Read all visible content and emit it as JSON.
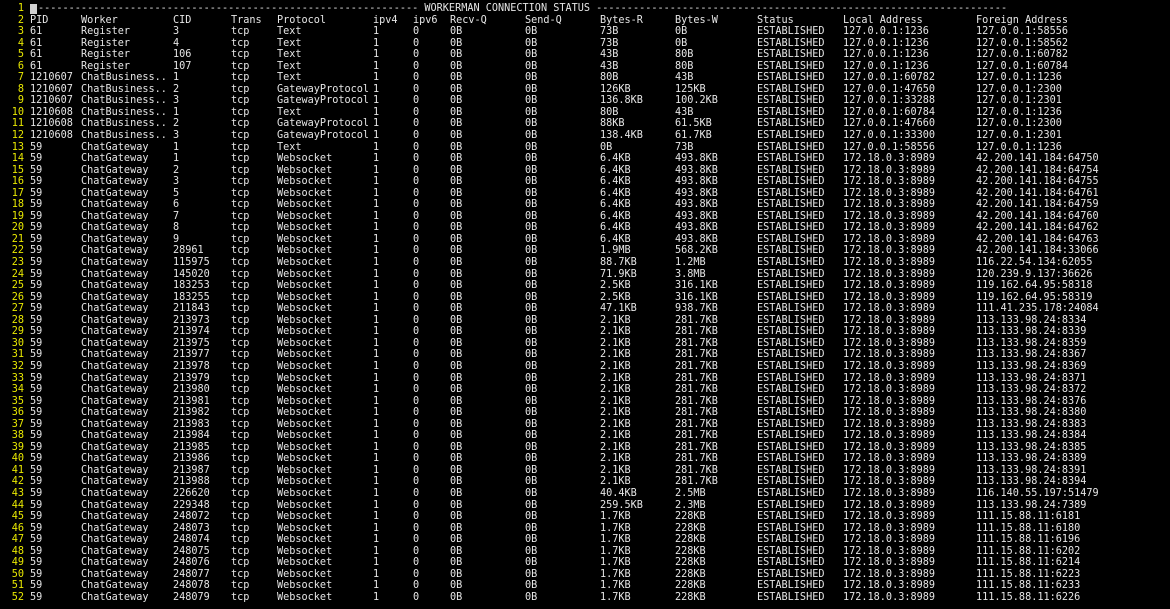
{
  "title_line": "-------------------------------------------------------------- WORKERMAN CONNECTION STATUS -------------------------------------------------------------------",
  "line_numbers": [
    "1",
    "2",
    "3",
    "4",
    "5",
    "6",
    "7",
    "8",
    "9",
    "10",
    "11",
    "12",
    "13",
    "14",
    "15",
    "16",
    "17",
    "18",
    "19",
    "20",
    "21",
    "22",
    "23",
    "24",
    "25",
    "26",
    "27",
    "28",
    "29",
    "30",
    "31",
    "32",
    "33",
    "34",
    "35",
    "36",
    "37",
    "38",
    "39",
    "40",
    "41",
    "42",
    "43",
    "44",
    "45",
    "46",
    "47",
    "48",
    "49",
    "50",
    "51",
    "52"
  ],
  "header": [
    "PID",
    "Worker",
    "CID",
    "Trans",
    "Protocol",
    "ipv4",
    "ipv6",
    "Recv-Q",
    "Send-Q",
    "Bytes-R",
    "Bytes-W",
    "Status",
    "Local Address",
    "Foreign Address"
  ],
  "rows": [
    [
      "61",
      "Register",
      "3",
      "tcp",
      "Text",
      "1",
      "0",
      "0B",
      "0B",
      "73B",
      "0B",
      "ESTABLISHED",
      "127.0.0.1:1236",
      "127.0.0.1:58556"
    ],
    [
      "61",
      "Register",
      "4",
      "tcp",
      "Text",
      "1",
      "0",
      "0B",
      "0B",
      "73B",
      "0B",
      "ESTABLISHED",
      "127.0.0.1:1236",
      "127.0.0.1:58562"
    ],
    [
      "61",
      "Register",
      "106",
      "tcp",
      "Text",
      "1",
      "0",
      "0B",
      "0B",
      "43B",
      "80B",
      "ESTABLISHED",
      "127.0.0.1:1236",
      "127.0.0.1:60782"
    ],
    [
      "61",
      "Register",
      "107",
      "tcp",
      "Text",
      "1",
      "0",
      "0B",
      "0B",
      "43B",
      "80B",
      "ESTABLISHED",
      "127.0.0.1:1236",
      "127.0.0.1:60784"
    ],
    [
      "1210607",
      "ChatBusiness..",
      "1",
      "tcp",
      "Text",
      "1",
      "0",
      "0B",
      "0B",
      "80B",
      "43B",
      "ESTABLISHED",
      "127.0.0.1:60782",
      "127.0.0.1:1236"
    ],
    [
      "1210607",
      "ChatBusiness..",
      "2",
      "tcp",
      "GatewayProtocol",
      "1",
      "0",
      "0B",
      "0B",
      "126KB",
      "125KB",
      "ESTABLISHED",
      "127.0.0.1:47650",
      "127.0.0.1:2300"
    ],
    [
      "1210607",
      "ChatBusiness..",
      "3",
      "tcp",
      "GatewayProtocol",
      "1",
      "0",
      "0B",
      "0B",
      "136.8KB",
      "100.2KB",
      "ESTABLISHED",
      "127.0.0.1:33288",
      "127.0.0.1:2301"
    ],
    [
      "1210608",
      "ChatBusiness..",
      "1",
      "tcp",
      "Text",
      "1",
      "0",
      "0B",
      "0B",
      "80B",
      "43B",
      "ESTABLISHED",
      "127.0.0.1:60784",
      "127.0.0.1:1236"
    ],
    [
      "1210608",
      "ChatBusiness..",
      "2",
      "tcp",
      "GatewayProtocol",
      "1",
      "0",
      "0B",
      "0B",
      "88KB",
      "61.5KB",
      "ESTABLISHED",
      "127.0.0.1:47660",
      "127.0.0.1:2300"
    ],
    [
      "1210608",
      "ChatBusiness..",
      "3",
      "tcp",
      "GatewayProtocol",
      "1",
      "0",
      "0B",
      "0B",
      "138.4KB",
      "61.7KB",
      "ESTABLISHED",
      "127.0.0.1:33300",
      "127.0.0.1:2301"
    ],
    [
      "59",
      "ChatGateway",
      "1",
      "tcp",
      "Text",
      "1",
      "0",
      "0B",
      "0B",
      "0B",
      "73B",
      "ESTABLISHED",
      "127.0.0.1:58556",
      "127.0.0.1:1236"
    ],
    [
      "59",
      "ChatGateway",
      "1",
      "tcp",
      "Websocket",
      "1",
      "0",
      "0B",
      "0B",
      "6.4KB",
      "493.8KB",
      "ESTABLISHED",
      "172.18.0.3:8989",
      "42.200.141.184:64750"
    ],
    [
      "59",
      "ChatGateway",
      "2",
      "tcp",
      "Websocket",
      "1",
      "0",
      "0B",
      "0B",
      "6.4KB",
      "493.8KB",
      "ESTABLISHED",
      "172.18.0.3:8989",
      "42.200.141.184:64754"
    ],
    [
      "59",
      "ChatGateway",
      "3",
      "tcp",
      "Websocket",
      "1",
      "0",
      "0B",
      "0B",
      "6.4KB",
      "493.8KB",
      "ESTABLISHED",
      "172.18.0.3:8989",
      "42.200.141.184:64755"
    ],
    [
      "59",
      "ChatGateway",
      "5",
      "tcp",
      "Websocket",
      "1",
      "0",
      "0B",
      "0B",
      "6.4KB",
      "493.8KB",
      "ESTABLISHED",
      "172.18.0.3:8989",
      "42.200.141.184:64761"
    ],
    [
      "59",
      "ChatGateway",
      "6",
      "tcp",
      "Websocket",
      "1",
      "0",
      "0B",
      "0B",
      "6.4KB",
      "493.8KB",
      "ESTABLISHED",
      "172.18.0.3:8989",
      "42.200.141.184:64759"
    ],
    [
      "59",
      "ChatGateway",
      "7",
      "tcp",
      "Websocket",
      "1",
      "0",
      "0B",
      "0B",
      "6.4KB",
      "493.8KB",
      "ESTABLISHED",
      "172.18.0.3:8989",
      "42.200.141.184:64760"
    ],
    [
      "59",
      "ChatGateway",
      "8",
      "tcp",
      "Websocket",
      "1",
      "0",
      "0B",
      "0B",
      "6.4KB",
      "493.8KB",
      "ESTABLISHED",
      "172.18.0.3:8989",
      "42.200.141.184:64762"
    ],
    [
      "59",
      "ChatGateway",
      "9",
      "tcp",
      "Websocket",
      "1",
      "0",
      "0B",
      "0B",
      "6.4KB",
      "493.8KB",
      "ESTABLISHED",
      "172.18.0.3:8989",
      "42.200.141.184:64763"
    ],
    [
      "59",
      "ChatGateway",
      "28961",
      "tcp",
      "Websocket",
      "1",
      "0",
      "0B",
      "0B",
      "1.9MB",
      "568.2KB",
      "ESTABLISHED",
      "172.18.0.3:8989",
      "42.200.141.184:33066"
    ],
    [
      "59",
      "ChatGateway",
      "115975",
      "tcp",
      "Websocket",
      "1",
      "0",
      "0B",
      "0B",
      "88.7KB",
      "1.2MB",
      "ESTABLISHED",
      "172.18.0.3:8989",
      "116.22.54.134:62055"
    ],
    [
      "59",
      "ChatGateway",
      "145020",
      "tcp",
      "Websocket",
      "1",
      "0",
      "0B",
      "0B",
      "71.9KB",
      "3.8MB",
      "ESTABLISHED",
      "172.18.0.3:8989",
      "120.239.9.137:36626"
    ],
    [
      "59",
      "ChatGateway",
      "183253",
      "tcp",
      "Websocket",
      "1",
      "0",
      "0B",
      "0B",
      "2.5KB",
      "316.1KB",
      "ESTABLISHED",
      "172.18.0.3:8989",
      "119.162.64.95:58318"
    ],
    [
      "59",
      "ChatGateway",
      "183255",
      "tcp",
      "Websocket",
      "1",
      "0",
      "0B",
      "0B",
      "2.5KB",
      "316.1KB",
      "ESTABLISHED",
      "172.18.0.3:8989",
      "119.162.64.95:58319"
    ],
    [
      "59",
      "ChatGateway",
      "211843",
      "tcp",
      "Websocket",
      "1",
      "0",
      "0B",
      "0B",
      "47.1KB",
      "938.7KB",
      "ESTABLISHED",
      "172.18.0.3:8989",
      "111.41.235.178:24084"
    ],
    [
      "59",
      "ChatGateway",
      "213973",
      "tcp",
      "Websocket",
      "1",
      "0",
      "0B",
      "0B",
      "2.1KB",
      "281.7KB",
      "ESTABLISHED",
      "172.18.0.3:8989",
      "113.133.98.24:8334"
    ],
    [
      "59",
      "ChatGateway",
      "213974",
      "tcp",
      "Websocket",
      "1",
      "0",
      "0B",
      "0B",
      "2.1KB",
      "281.7KB",
      "ESTABLISHED",
      "172.18.0.3:8989",
      "113.133.98.24:8339"
    ],
    [
      "59",
      "ChatGateway",
      "213975",
      "tcp",
      "Websocket",
      "1",
      "0",
      "0B",
      "0B",
      "2.1KB",
      "281.7KB",
      "ESTABLISHED",
      "172.18.0.3:8989",
      "113.133.98.24:8359"
    ],
    [
      "59",
      "ChatGateway",
      "213977",
      "tcp",
      "Websocket",
      "1",
      "0",
      "0B",
      "0B",
      "2.1KB",
      "281.7KB",
      "ESTABLISHED",
      "172.18.0.3:8989",
      "113.133.98.24:8367"
    ],
    [
      "59",
      "ChatGateway",
      "213978",
      "tcp",
      "Websocket",
      "1",
      "0",
      "0B",
      "0B",
      "2.1KB",
      "281.7KB",
      "ESTABLISHED",
      "172.18.0.3:8989",
      "113.133.98.24:8369"
    ],
    [
      "59",
      "ChatGateway",
      "213979",
      "tcp",
      "Websocket",
      "1",
      "0",
      "0B",
      "0B",
      "2.1KB",
      "281.7KB",
      "ESTABLISHED",
      "172.18.0.3:8989",
      "113.133.98.24:8371"
    ],
    [
      "59",
      "ChatGateway",
      "213980",
      "tcp",
      "Websocket",
      "1",
      "0",
      "0B",
      "0B",
      "2.1KB",
      "281.7KB",
      "ESTABLISHED",
      "172.18.0.3:8989",
      "113.133.98.24:8372"
    ],
    [
      "59",
      "ChatGateway",
      "213981",
      "tcp",
      "Websocket",
      "1",
      "0",
      "0B",
      "0B",
      "2.1KB",
      "281.7KB",
      "ESTABLISHED",
      "172.18.0.3:8989",
      "113.133.98.24:8376"
    ],
    [
      "59",
      "ChatGateway",
      "213982",
      "tcp",
      "Websocket",
      "1",
      "0",
      "0B",
      "0B",
      "2.1KB",
      "281.7KB",
      "ESTABLISHED",
      "172.18.0.3:8989",
      "113.133.98.24:8380"
    ],
    [
      "59",
      "ChatGateway",
      "213983",
      "tcp",
      "Websocket",
      "1",
      "0",
      "0B",
      "0B",
      "2.1KB",
      "281.7KB",
      "ESTABLISHED",
      "172.18.0.3:8989",
      "113.133.98.24:8383"
    ],
    [
      "59",
      "ChatGateway",
      "213984",
      "tcp",
      "Websocket",
      "1",
      "0",
      "0B",
      "0B",
      "2.1KB",
      "281.7KB",
      "ESTABLISHED",
      "172.18.0.3:8989",
      "113.133.98.24:8384"
    ],
    [
      "59",
      "ChatGateway",
      "213985",
      "tcp",
      "Websocket",
      "1",
      "0",
      "0B",
      "0B",
      "2.1KB",
      "281.7KB",
      "ESTABLISHED",
      "172.18.0.3:8989",
      "113.133.98.24:8385"
    ],
    [
      "59",
      "ChatGateway",
      "213986",
      "tcp",
      "Websocket",
      "1",
      "0",
      "0B",
      "0B",
      "2.1KB",
      "281.7KB",
      "ESTABLISHED",
      "172.18.0.3:8989",
      "113.133.98.24:8389"
    ],
    [
      "59",
      "ChatGateway",
      "213987",
      "tcp",
      "Websocket",
      "1",
      "0",
      "0B",
      "0B",
      "2.1KB",
      "281.7KB",
      "ESTABLISHED",
      "172.18.0.3:8989",
      "113.133.98.24:8391"
    ],
    [
      "59",
      "ChatGateway",
      "213988",
      "tcp",
      "Websocket",
      "1",
      "0",
      "0B",
      "0B",
      "2.1KB",
      "281.7KB",
      "ESTABLISHED",
      "172.18.0.3:8989",
      "113.133.98.24:8394"
    ],
    [
      "59",
      "ChatGateway",
      "226620",
      "tcp",
      "Websocket",
      "1",
      "0",
      "0B",
      "0B",
      "40.4KB",
      "2.5MB",
      "ESTABLISHED",
      "172.18.0.3:8989",
      "116.140.55.197:51479"
    ],
    [
      "59",
      "ChatGateway",
      "229348",
      "tcp",
      "Websocket",
      "1",
      "0",
      "0B",
      "0B",
      "259.5KB",
      "2.3MB",
      "ESTABLISHED",
      "172.18.0.3:8989",
      "113.133.98.24:7389"
    ],
    [
      "59",
      "ChatGateway",
      "248072",
      "tcp",
      "Websocket",
      "1",
      "0",
      "0B",
      "0B",
      "1.7KB",
      "228KB",
      "ESTABLISHED",
      "172.18.0.3:8989",
      "111.15.88.11:6181"
    ],
    [
      "59",
      "ChatGateway",
      "248073",
      "tcp",
      "Websocket",
      "1",
      "0",
      "0B",
      "0B",
      "1.7KB",
      "228KB",
      "ESTABLISHED",
      "172.18.0.3:8989",
      "111.15.88.11:6180"
    ],
    [
      "59",
      "ChatGateway",
      "248074",
      "tcp",
      "Websocket",
      "1",
      "0",
      "0B",
      "0B",
      "1.7KB",
      "228KB",
      "ESTABLISHED",
      "172.18.0.3:8989",
      "111.15.88.11:6196"
    ],
    [
      "59",
      "ChatGateway",
      "248075",
      "tcp",
      "Websocket",
      "1",
      "0",
      "0B",
      "0B",
      "1.7KB",
      "228KB",
      "ESTABLISHED",
      "172.18.0.3:8989",
      "111.15.88.11:6202"
    ],
    [
      "59",
      "ChatGateway",
      "248076",
      "tcp",
      "Websocket",
      "1",
      "0",
      "0B",
      "0B",
      "1.7KB",
      "228KB",
      "ESTABLISHED",
      "172.18.0.3:8989",
      "111.15.88.11:6214"
    ],
    [
      "59",
      "ChatGateway",
      "248077",
      "tcp",
      "Websocket",
      "1",
      "0",
      "0B",
      "0B",
      "1.7KB",
      "228KB",
      "ESTABLISHED",
      "172.18.0.3:8989",
      "111.15.88.11:6223"
    ],
    [
      "59",
      "ChatGateway",
      "248078",
      "tcp",
      "Websocket",
      "1",
      "0",
      "0B",
      "0B",
      "1.7KB",
      "228KB",
      "ESTABLISHED",
      "172.18.0.3:8989",
      "111.15.88.11:6233"
    ],
    [
      "59",
      "ChatGateway",
      "248079",
      "tcp",
      "Websocket",
      "1",
      "0",
      "0B",
      "0B",
      "1.7KB",
      "228KB",
      "ESTABLISHED",
      "172.18.0.3:8989",
      "111.15.88.11:6226"
    ]
  ],
  "colors": {
    "background": "#000000",
    "text": "#e6e6e6",
    "line_numbers": "#e8e800"
  }
}
